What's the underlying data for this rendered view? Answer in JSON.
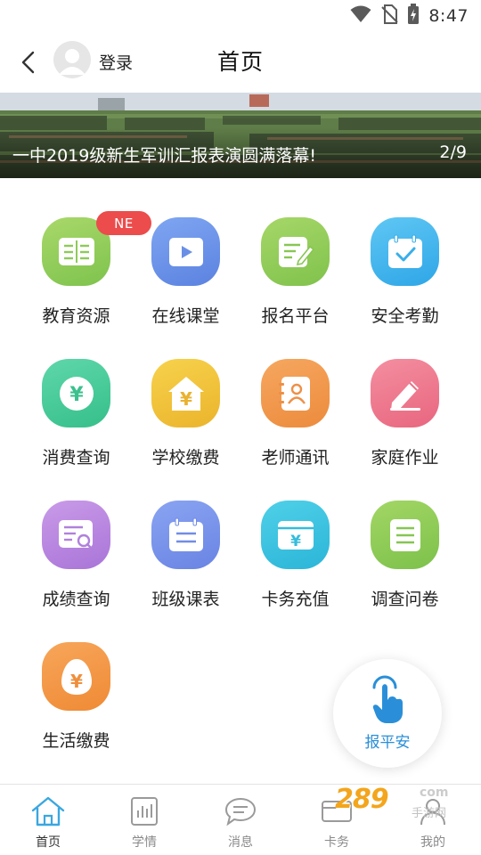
{
  "status_bar": {
    "time": "8:47",
    "icons": [
      "wifi-icon",
      "no-sim-icon",
      "battery-icon"
    ]
  },
  "header": {
    "back_icon": "chevron-left-icon",
    "avatar_icon": "user-avatar-icon",
    "login_label": "登录",
    "title": "首页"
  },
  "banner": {
    "caption": "一中2019级新生军训汇报表演圆满落幕!",
    "indicator": "2/9"
  },
  "grid": {
    "items": [
      {
        "label": "教育资源",
        "icon": "book-icon",
        "badge": "NE"
      },
      {
        "label": "在线课堂",
        "icon": "play-video-icon"
      },
      {
        "label": "报名平台",
        "icon": "edit-form-icon"
      },
      {
        "label": "安全考勤",
        "icon": "calendar-check-icon"
      },
      {
        "label": "消费查询",
        "icon": "yuan-circle-icon"
      },
      {
        "label": "学校缴费",
        "icon": "yuan-house-icon"
      },
      {
        "label": "老师通讯",
        "icon": "contacts-book-icon"
      },
      {
        "label": "家庭作业",
        "icon": "pencil-icon"
      },
      {
        "label": "成绩查询",
        "icon": "document-search-icon"
      },
      {
        "label": "班级课表",
        "icon": "schedule-icon"
      },
      {
        "label": "卡务充值",
        "icon": "card-yuan-icon"
      },
      {
        "label": "调查问卷",
        "icon": "questionnaire-icon"
      },
      {
        "label": "生活缴费",
        "icon": "yuan-egg-icon"
      }
    ]
  },
  "safe_report": {
    "label": "报平安",
    "icon": "tap-finger-icon"
  },
  "bottom_nav": {
    "items": [
      {
        "label": "首页",
        "icon": "home-icon",
        "active": true
      },
      {
        "label": "学情",
        "icon": "bar-chart-icon",
        "active": false
      },
      {
        "label": "消息",
        "icon": "chat-bubble-icon",
        "active": false
      },
      {
        "label": "卡务",
        "icon": "card-icon",
        "active": false
      },
      {
        "label": "我的",
        "icon": "profile-icon",
        "active": false
      }
    ]
  },
  "watermark": {
    "text": "289",
    "suffix": "com",
    "sub": "手游网"
  },
  "colors": {
    "accent_blue": "#2a8fd8",
    "badge_red": "#ec4c4c",
    "nav_inactive": "#8a8a8a"
  }
}
